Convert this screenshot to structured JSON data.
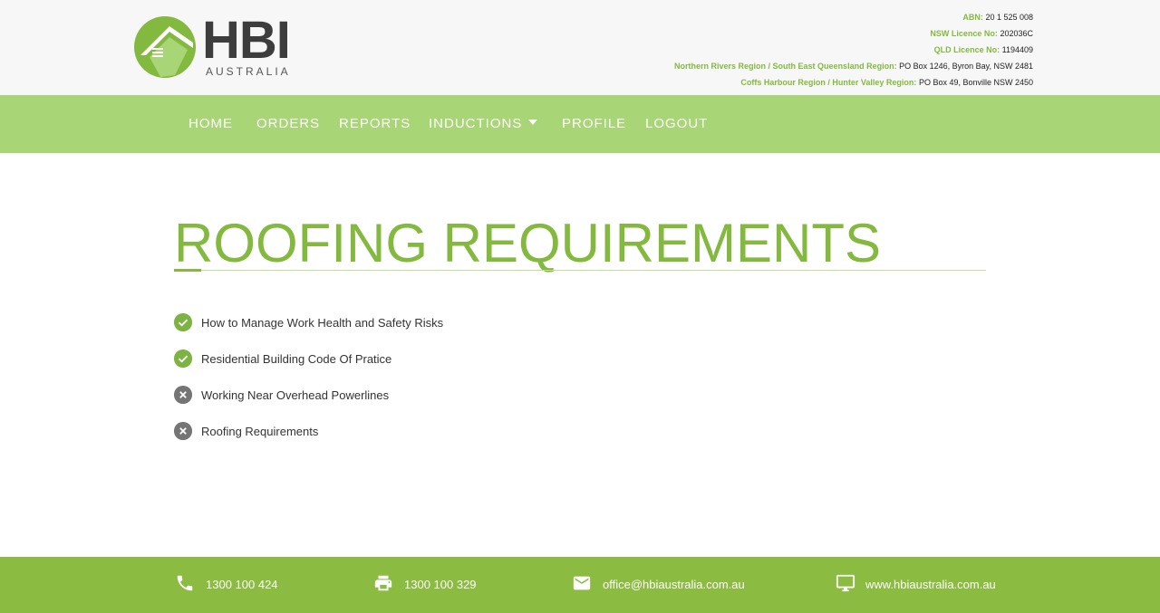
{
  "brand": {
    "name": "HBI",
    "sub": "AUSTRALIA"
  },
  "info": [
    {
      "label": "ABN:",
      "value": "20 1 525 008"
    },
    {
      "label": "NSW Licence No:",
      "value": "202036C"
    },
    {
      "label": "QLD Licence No:",
      "value": "1194409"
    },
    {
      "label": "Northern Rivers Region / South East Queensland Region:",
      "value": "PO Box 1246, Byron Bay, NSW 2481"
    },
    {
      "label": "Coffs Harbour Region / Hunter Valley Region:",
      "value": "PO Box 49, Bonville NSW 2450"
    }
  ],
  "nav": {
    "home": "HOME",
    "orders": "ORDERS",
    "reports": "REPORTS",
    "inductions": "INDUCTIONS",
    "profile": "PROFILE",
    "logout": "LOGOUT"
  },
  "main": {
    "title": "ROOFING REQUIREMENTS",
    "items": [
      {
        "label": "How to Manage Work Health and Safety Risks",
        "status": "complete"
      },
      {
        "label": "Residential Building Code Of Pratice",
        "status": "complete"
      },
      {
        "label": "Working Near Overhead Powerlines",
        "status": "incomplete"
      },
      {
        "label": "Roofing Requirements",
        "status": "incomplete"
      }
    ]
  },
  "footer": {
    "phone": "1300 100 424",
    "fax": "1300 100 329",
    "email": "office@hbiaustralia.com.au",
    "web": "www.hbiaustralia.com.au"
  },
  "colors": {
    "brand_green": "#84b93f",
    "nav_green": "#a8d575",
    "footer_green": "#8bbb40",
    "fail_grey": "#757575"
  }
}
